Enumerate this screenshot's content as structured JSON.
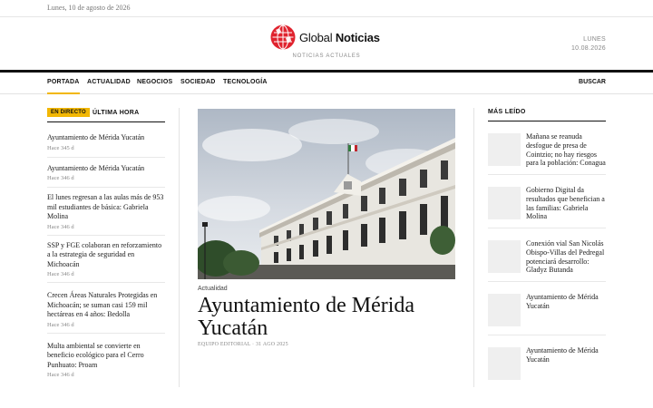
{
  "topbar": {
    "date": "Lunes, 10 de agosto de 2026"
  },
  "masthead": {
    "logo_light": "Global",
    "logo_bold": "Noticias",
    "tagline": "NOTICIAS ACTUALES",
    "day": "LUNES",
    "date_short": "10.08.2026",
    "logo_color": "#e0232e"
  },
  "nav": {
    "items": [
      "PORTADA",
      "ACTUALIDAD",
      "NEGOCIOS",
      "SOCIEDAD",
      "TECNOLOGÍA"
    ],
    "active": "PORTADA",
    "search": "BUSCAR",
    "accent": "#f2b705"
  },
  "live": {
    "badge": "EN DIRECTO",
    "title": "ÚLTIMA HORA",
    "items": [
      {
        "headline": "Ayuntamiento de Mérida Yucatán",
        "meta": "Hace 345 d"
      },
      {
        "headline": "Ayuntamiento de Mérida Yucatán",
        "meta": "Hace 346 d"
      },
      {
        "headline": "El lunes regresan a las aulas más de 953 mil estudiantes de básica: Gabriela Molina",
        "meta": "Hace 346 d"
      },
      {
        "headline": "SSP y FGE colaboran en reforzamiento a la estrategia de seguridad en Michoacán",
        "meta": "Hace 346 d"
      },
      {
        "headline": "Crecen Áreas Naturales Protegidas en Michoacán; se suman casi 159 mil hectáreas en 4 años: Bedolla",
        "meta": "Hace 346 d"
      },
      {
        "headline": "Multa ambiental se convierte en beneficio ecológico para el Cerro Punhuato: Proam",
        "meta": "Hace 346 d"
      }
    ]
  },
  "featured": {
    "category": "Actualidad",
    "title": "Ayuntamiento de Mérida Yucatán",
    "byline": "EQUIPO EDITORIAL · 31 AGO 2025",
    "image_icon": "colonial-building-photo"
  },
  "most_read": {
    "title": "MÁS LEÍDO",
    "items": [
      {
        "title": "Mañana se reanuda desfogue de presa de Cointzio; no hay riesgos para la población: Conagua"
      },
      {
        "title": "Gobierno Digital da resultados que benefician a las familias: Gabriela Molina"
      },
      {
        "title": "Conexión vial San Nicolás Obispo-Villas del Pedregal potenciará desarrollo: Gladyz Butanda"
      },
      {
        "title": "Ayuntamiento de Mérida Yucatán"
      },
      {
        "title": "Ayuntamiento de Mérida Yucatán"
      }
    ]
  }
}
